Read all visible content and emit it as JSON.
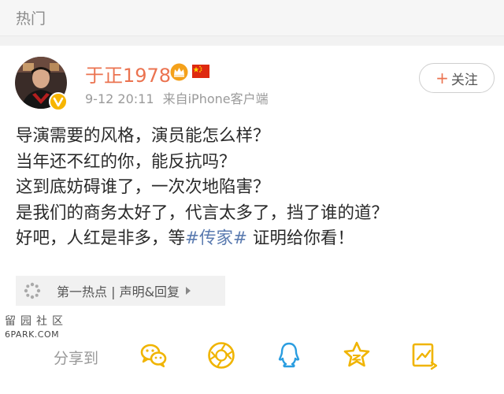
{
  "header": {
    "title": "热门"
  },
  "post": {
    "author": "于正1978",
    "time": "9-12 20:11",
    "source": "来自iPhone客户端",
    "follow_label": "关注",
    "follow_prefix": "+",
    "lines": [
      "导演需要的风格，演员能怎么样？",
      "当年还不红的你，能反抗吗？",
      "这到底妨碍谁了，一次次地陷害？",
      "是我们的商务太好了，代言太多了，挡了谁的道？"
    ],
    "last_line": {
      "before": "好吧，人红是非多，等",
      "hashtag": "#传家#",
      "after": " 证明给你看！"
    },
    "linked_card": {
      "text": "第一热点 | 声明&回复"
    }
  },
  "watermark": {
    "glyphs": "留园社区",
    "site": "6PARK.COM"
  },
  "share": {
    "label": "分享到",
    "targets": [
      "wechat-icon",
      "moments-icon",
      "qq-icon",
      "qzone-icon",
      "forward-icon"
    ]
  },
  "colors": {
    "author": "#eb7350",
    "hashtag": "#5b7bb0",
    "icon": "#f0b400",
    "qq_blue": "#2a9de0"
  }
}
